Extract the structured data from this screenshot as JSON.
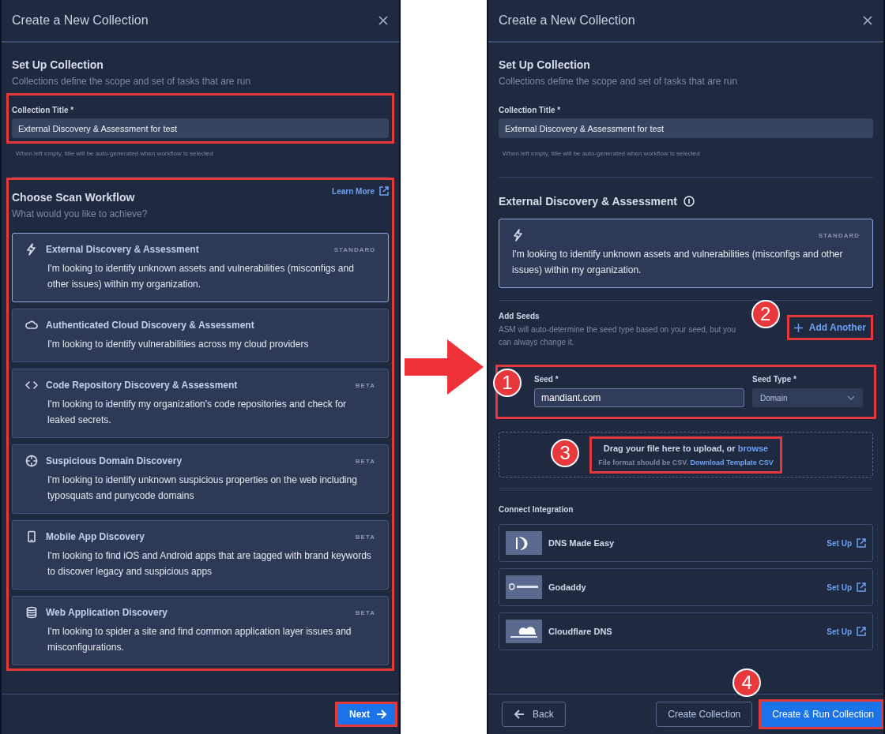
{
  "left_panel": {
    "title": "Create a New Collection",
    "setup": {
      "heading": "Set Up Collection",
      "subtitle": "Collections define the scope and set of tasks that are run"
    },
    "title_field": {
      "label": "Collection Title *",
      "value": "External Discovery & Assessment for test",
      "hint": "When left empty, title will be auto-generated when workflow is selected",
      "highlighted": true
    },
    "workflow": {
      "heading": "Choose Scan Workflow",
      "subtitle": "What would you like to achieve?",
      "learn_more": "Learn More",
      "highlighted": true,
      "options": [
        {
          "kind": "external",
          "title": "External Discovery & Assessment",
          "badge": "STANDARD",
          "description": "I'm looking to identify unknown assets and vulnerabilities (misconfigs and other issues) within my organization.",
          "selected": true
        },
        {
          "kind": "cloud",
          "title": "Authenticated Cloud Discovery & Assessment",
          "description": "I'm looking to identify vulnerabilities across my cloud providers",
          "selected": false
        },
        {
          "kind": "repository",
          "title": "Code Repository Discovery & Assessment",
          "badge": "BETA",
          "description": "I'm looking to identify my organization's code repositories and check for leaked secrets.",
          "selected": false
        },
        {
          "kind": "domain",
          "title": "Suspicious Domain Discovery",
          "badge": "BETA",
          "description": "I'm looking to identify unknown suspicious properties on the web including typosquats and punycode domains",
          "selected": false
        },
        {
          "kind": "mobile",
          "title": "Mobile App Discovery",
          "badge": "BETA",
          "description": "I'm looking to find iOS and Android apps that are tagged with brand keywords to discover legacy and suspicious apps",
          "selected": false
        },
        {
          "kind": "webapp",
          "title": "Web Application Discovery",
          "badge": "BETA",
          "description": "I'm looking to spider a site and find common application layer issues and misconfigurations.",
          "selected": false
        }
      ]
    },
    "next_button": {
      "label": "Next",
      "highlighted": true
    }
  },
  "right_panel": {
    "title": "Create a New Collection",
    "setup": {
      "heading": "Set Up Collection",
      "subtitle": "Collections define the scope and set of tasks that are run"
    },
    "title_field": {
      "label": "Collection Title *",
      "value": "External Discovery & Assessment for test",
      "hint": "When left empty, title will be auto-generated when workflow is selected",
      "highlighted": false
    },
    "workflow": {
      "heading": "External Discovery & Assessment",
      "kind": "external",
      "badge": "STANDARD",
      "description": "I'm looking to identify unknown assets and vulnerabilities (misconfigs and other issues) within my organization."
    },
    "seeds": {
      "heading": "Add Seeds",
      "description": "ASM will auto-determine the seed type based on your seed, but you can always change it.",
      "add_another": {
        "label": "Add Another",
        "highlighted": true,
        "callout": "2"
      },
      "seed_row": {
        "seed_label": "Seed *",
        "seed_value": "mandiant.com",
        "type_label": "Seed Type *",
        "type_value": "Domain",
        "highlighted": true,
        "callout": "1"
      },
      "upload": {
        "prompt": "Drag your file here to upload, or",
        "browse_link": "browse",
        "format_note": "File format should be CSV.",
        "template_link": "Download Template CSV",
        "highlighted": true,
        "callout": "3"
      }
    },
    "integrations": {
      "heading": "Connect Integration",
      "items": [
        {
          "kind": "dnsmadeeasy",
          "name": "DNS Made Easy",
          "action": "Set Up"
        },
        {
          "kind": "godaddy",
          "name": "Godaddy",
          "action": "Set Up"
        },
        {
          "kind": "cloudflare",
          "name": "Cloudflare DNS",
          "action": "Set Up"
        }
      ]
    },
    "footer": {
      "back": "Back",
      "create": "Create Collection",
      "create_run": {
        "label": "Create & Run Collection",
        "highlighted": true,
        "callout": "4"
      }
    }
  }
}
